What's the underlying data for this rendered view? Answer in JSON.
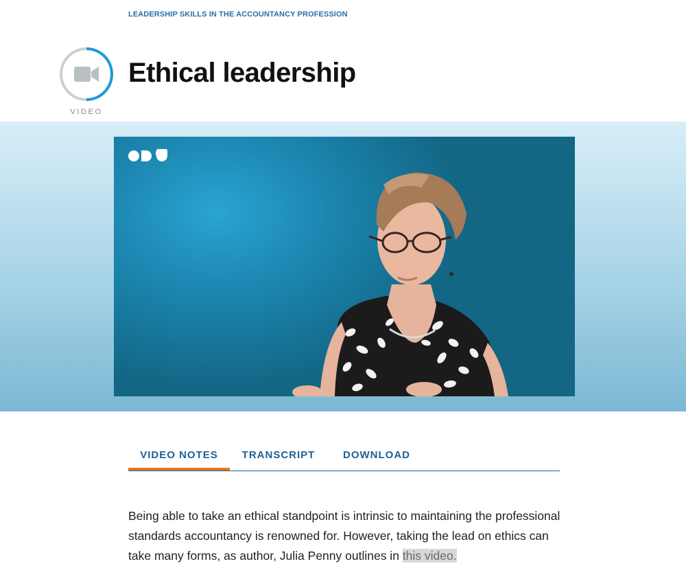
{
  "breadcrumb": "LEADERSHIP SKILLS IN THE ACCOUNTANCY PROFESSION",
  "media_type_label": "VIDEO",
  "title": "Ethical leadership",
  "tabs": [
    {
      "label": "VIDEO NOTES",
      "active": true
    },
    {
      "label": "TRANSCRIPT",
      "active": false
    },
    {
      "label": "DOWNLOAD",
      "active": false
    }
  ],
  "body": {
    "text_before": "Being able to take an ethical standpoint is intrinsic to maintaining the professional standards accountancy is renowned for. However, taking the lead on ethics can take many forms, as author, Julia Penny outlines in",
    "link_text": "this video."
  },
  "colors": {
    "accent": "#d97b1c",
    "link": "#2a6fa8",
    "tab_text": "#1f5f93",
    "icon_ring": "#1a9bd7"
  },
  "icons": {
    "media": "video-camera-icon",
    "player_logo": "brand-logo"
  }
}
